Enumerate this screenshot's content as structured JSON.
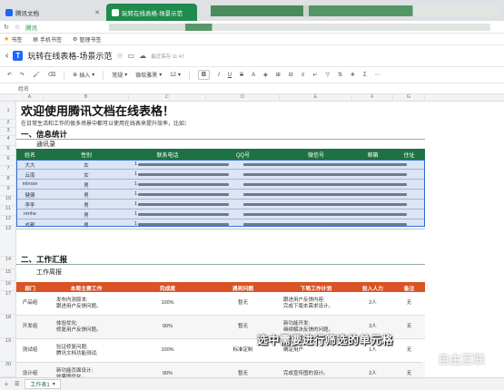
{
  "browser": {
    "tabs": [
      {
        "title": "腾讯文档",
        "active": false
      },
      {
        "title": "玩转在线表格-场景示范",
        "active": true
      }
    ],
    "address_label": "腾讯",
    "bookmarks": [
      {
        "label": "书签"
      },
      {
        "label": "手机书签"
      },
      {
        "label": "管理书签"
      }
    ]
  },
  "doc": {
    "title": "玩转在线表格-场景示范",
    "saved": "最近保存 11:47"
  },
  "toolbar": {
    "insert": "插入",
    "format_normal": "常规",
    "font": "微软雅黑",
    "font_size": "12",
    "bold": "B",
    "italic": "I",
    "underline": "U",
    "strike": "S",
    "color": "A"
  },
  "formula_bar": {
    "value": "姓名"
  },
  "columns": [
    "A",
    "B",
    "C",
    "D",
    "E",
    "F",
    "G"
  ],
  "rows": [
    "1",
    "2",
    "3",
    "4",
    "5",
    "6",
    "7",
    "8",
    "9",
    "10",
    "11",
    "12",
    "13",
    "14",
    "15",
    "16",
    "17",
    "18",
    "19",
    "20"
  ],
  "sheet": {
    "title": "欢迎使用腾讯文档在线表格！",
    "intro": "在日常生活和工作的很多场景中都可以使用在线表来提升效率，比如：",
    "section1": "一、信息统计",
    "section1_caption": "通讯录",
    "contacts_headers": [
      "姓名",
      "性别",
      "联系电话",
      "QQ号",
      "微信号",
      "邮箱",
      "住址"
    ],
    "contacts_rows": [
      {
        "name": "大大",
        "gender": "女",
        "phone": "1"
      },
      {
        "name": "云南",
        "gender": "女",
        "phone": "1"
      },
      {
        "name": "minran",
        "gender": "男",
        "phone": "1"
      },
      {
        "name": "健健",
        "gender": "男",
        "phone": "1"
      },
      {
        "name": "李李",
        "gender": "男",
        "phone": "1"
      },
      {
        "name": "renhe",
        "gender": "男",
        "phone": "1"
      },
      {
        "name": "成都",
        "gender": "男",
        "phone": "1"
      }
    ],
    "section2": "二、工作汇报",
    "section2_caption": "工作周报",
    "weekly_headers": [
      "部门",
      "本周主要工作",
      "完成度",
      "遇到问题",
      "下周工作计划",
      "投入人力",
      "备注"
    ],
    "weekly_rows": [
      {
        "dept": "产品组",
        "work": "发布内测版本;\n跟进用户反馈问题。",
        "done": "100%",
        "issue": "暂无",
        "plan": "跟进用户反馈内容;\n完成下版本需求设计。",
        "people": "2人",
        "note": "无"
      },
      {
        "dept": "开发组",
        "work": "体验优化;\n修复用户反馈问题。",
        "done": "90%",
        "issue": "暂无",
        "plan": "新功能开发;\n继续解决反馈的问题。",
        "people": "3人",
        "note": "无"
      },
      {
        "dept": "测试组",
        "work": "验证修复问题;\n腾讯文档功能测试;",
        "done": "100%",
        "issue": "标准定制",
        "plan": "确定用户",
        "people": "1人",
        "note": "无"
      },
      {
        "dept": "设计组",
        "work": "新功能页面设计;\n效果图优化。",
        "done": "90%",
        "issue": "暂无",
        "plan": "完成宣传图的设计。",
        "people": "2人",
        "note": "无"
      }
    ]
  },
  "overlay": {
    "caption": "选中需要进行筛选的单元格",
    "watermark": "自由互联"
  },
  "sheetbar": {
    "tab": "工作表1"
  },
  "colors": {
    "contacts_header": "#1e7145",
    "weekly_header": "#d95324",
    "selection": "#2f6fd6"
  }
}
